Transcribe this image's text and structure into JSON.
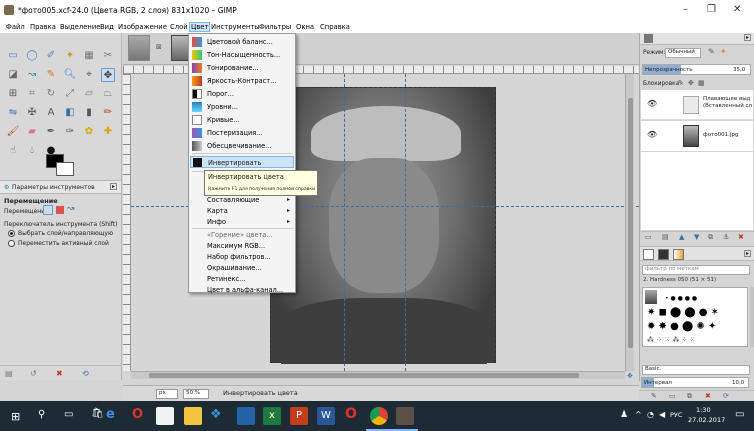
{
  "window": {
    "title": "*фото005.xcf-24.0 (Цвета RGB, 2 слоя) 831x1020 – GIMP",
    "minimize": "–",
    "maximize": "❐",
    "close": "✕"
  },
  "menubar": [
    "Файл",
    "Правка",
    "Выделение",
    "Вид",
    "Изображение",
    "Слой",
    "Цвет",
    "Инструменты",
    "Фильтры",
    "Окна",
    "Справка"
  ],
  "color_menu": {
    "items": [
      "Цветовой баланс...",
      "Тон-Насыщенность...",
      "Тонирование...",
      "Яркость-Контраст...",
      "Порог...",
      "Уровни...",
      "Кривые...",
      "Постеризация...",
      "Обесцвечивание..."
    ],
    "selected": "Инвертировать",
    "submenus": [
      "Составляющие",
      "Карта",
      "Инфо"
    ],
    "items2": [
      "«Горение» цвета...",
      "Максимум RGB...",
      "Набор фильтров...",
      "Окрашивание...",
      "Ретинекс...",
      "Цвет в альфа-канал..."
    ]
  },
  "tooltip": {
    "title": "Инвертировать цвета",
    "hint": "Нажмите F1 для получения полной справки"
  },
  "tool_options": {
    "tab": "Параметры инструментов",
    "title": "Перемещение",
    "mode_label": "Перемещение:",
    "switch_label": "Переключатель инструмента (Shift)",
    "opt1": "Выбрать слой/направляющую",
    "opt2": "Переместить активный слой"
  },
  "layers": {
    "mode_label": "Режим:",
    "mode_value": "Обычный",
    "opacity_label": "Непрозрачность",
    "opacity_value": "35,0",
    "lock_label": "Блокировка:",
    "layer1": "Плавающее выд (Вставленный сл",
    "layer2": "фото001.jpg"
  },
  "brushes": {
    "filter_placeholder": "фильтр по меткам",
    "brush_name": "2. Hardness 050 (51 × 51)",
    "preset": "Basic.",
    "interval_label": "Интервал",
    "interval_value": "10,0"
  },
  "statusbar": {
    "unit": "px",
    "zoom": "50 %",
    "message": "Инвертировать цвета"
  },
  "taskbar": {
    "lang": "РУС",
    "time": "1:30",
    "date": "27.02.2017"
  },
  "colors": {
    "accent": "#3a6ea5",
    "selected_bg": "#cde4f7",
    "tooltip_bg": "#ffffe1",
    "taskbar": "#1d2b34"
  }
}
